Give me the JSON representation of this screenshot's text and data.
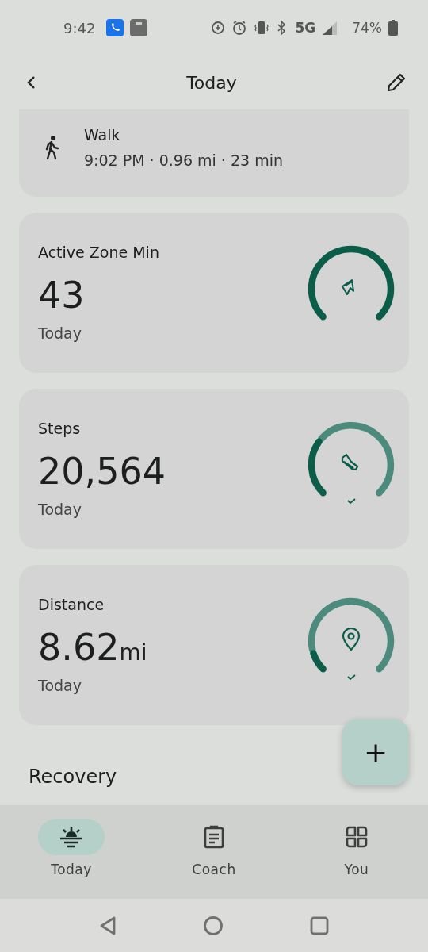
{
  "status_bar": {
    "time": "9:42",
    "network": "5G",
    "battery": "74%"
  },
  "header": {
    "title": "Today"
  },
  "walk": {
    "title": "Walk",
    "details": "9:02 PM · 0.96 mi · 23 min"
  },
  "metrics": [
    {
      "kind": "zone",
      "title": "Active Zone Min",
      "value": "43",
      "period": "Today",
      "goal_met": false
    },
    {
      "kind": "steps",
      "title": "Steps",
      "value": "20,564",
      "period": "Today",
      "goal_met": true
    },
    {
      "kind": "distance",
      "title": "Distance",
      "value": "8.62",
      "unit": "mi",
      "period": "Today",
      "goal_met": true
    }
  ],
  "add_button": {
    "label": "+"
  },
  "section_heading": "Recovery",
  "nav": [
    {
      "kind": "today",
      "label": "Today",
      "selected": true
    },
    {
      "kind": "coach",
      "label": "Coach",
      "selected": false
    },
    {
      "kind": "you",
      "label": "You",
      "selected": false
    }
  ]
}
